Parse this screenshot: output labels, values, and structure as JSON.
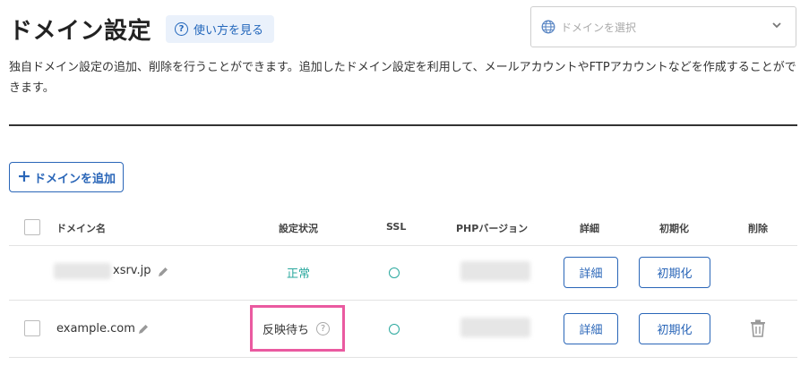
{
  "page": {
    "title": "ドメイン設定",
    "help_label": "使い方を見る",
    "description": "独自ドメイン設定の追加、削除を行うことができます。追加したドメイン設定を利用して、メールアカウントやFTPアカウントなどを作成することができます。"
  },
  "domain_select": {
    "placeholder": "ドメインを選択"
  },
  "add_button": {
    "label": "ドメインを追加"
  },
  "table": {
    "headers": {
      "domain": "ドメイン名",
      "status": "設定状況",
      "ssl": "SSL",
      "php": "PHPバージョン",
      "detail": "詳細",
      "init": "初期化",
      "delete": "削除"
    },
    "rows": [
      {
        "domain": "xsrv.jp",
        "status": "正常",
        "ssl": "○",
        "detail": "詳細",
        "init": "初期化"
      },
      {
        "domain": "example.com",
        "status": "反映待ち",
        "ssl": "○",
        "detail": "詳細",
        "init": "初期化"
      }
    ]
  },
  "colors": {
    "accent": "#2a66b8",
    "ok": "#2aa89e",
    "highlight": "#ea5aa0"
  },
  "icons": [
    "question-circle-icon",
    "globe-icon",
    "chevron-down-icon",
    "plus-icon",
    "pencil-icon",
    "trash-icon"
  ]
}
